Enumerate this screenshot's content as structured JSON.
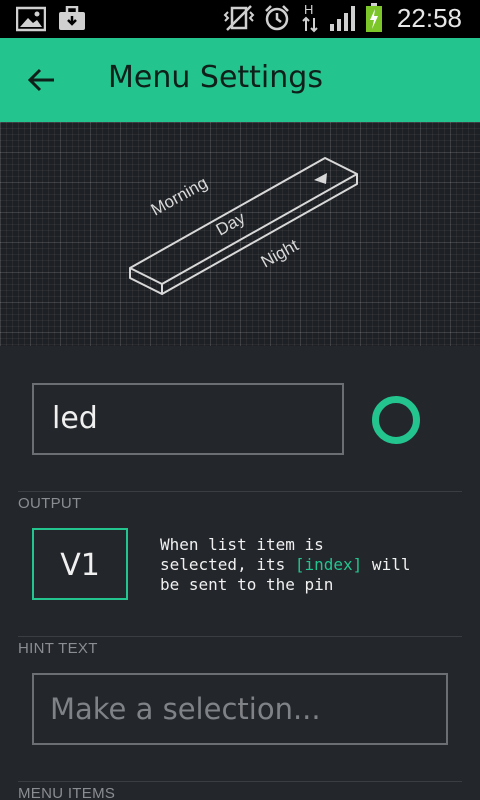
{
  "status_bar": {
    "time": "22:58",
    "network_type": "H",
    "icons": [
      "image-icon",
      "briefcase-icon",
      "vibrate-mute-icon",
      "alarm-icon",
      "data-arrows-icon",
      "signal-icon",
      "battery-charging-icon"
    ]
  },
  "app_bar": {
    "title": "Menu Settings",
    "back_icon": "arrow-left-icon"
  },
  "preview": {
    "items": [
      "Morning",
      "Day",
      "Night"
    ]
  },
  "name_field": {
    "value": "led"
  },
  "color": {
    "accent": "#23c48e",
    "appbar": "#23c48e",
    "background": "#23262b"
  },
  "output": {
    "label": "OUTPUT",
    "pin": "V1",
    "desc_line1": "When list item is",
    "desc_line2_pre": "selected, its ",
    "desc_line2_hl": "[index]",
    "desc_line2_post": " will",
    "desc_line3": "be sent to the pin"
  },
  "hint": {
    "label": "HINT TEXT",
    "placeholder": "Make a selection..."
  },
  "menu_items": {
    "label": "MENU ITEMS"
  }
}
